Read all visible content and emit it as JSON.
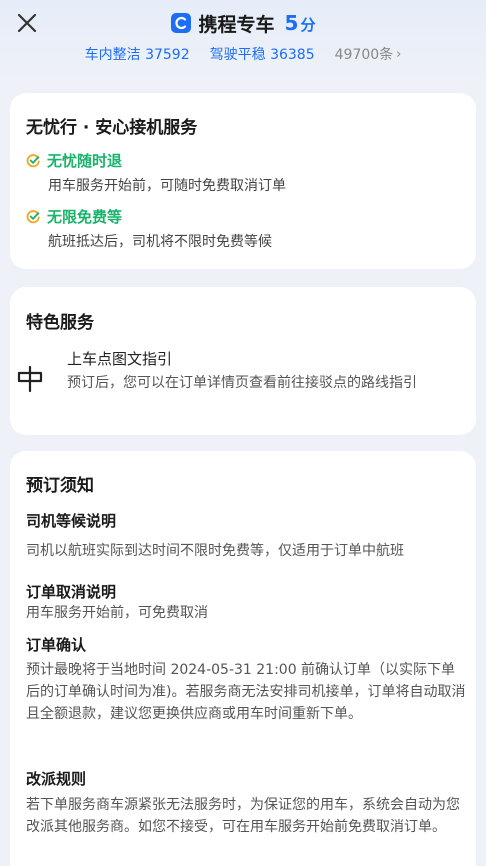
{
  "header": {
    "title": "携程专车",
    "score": "5",
    "score_unit": "分",
    "stats": [
      {
        "label": "车内整洁 37592"
      },
      {
        "label": "驾驶平稳 36385"
      }
    ],
    "review_count": "49700条"
  },
  "card_service": {
    "title": "无忧行 · 安心接机服务",
    "features": [
      {
        "name": "无忧随时退",
        "desc": "用车服务开始前，可随时免费取消订单"
      },
      {
        "name": "无限免费等",
        "desc": "航班抵达后，司机将不限时免费等候"
      }
    ]
  },
  "card_special": {
    "title": "特色服务",
    "item_name": "上车点图文指引",
    "item_desc": "预订后，您可以在订单详情页查看前往接驳点的路线指引"
  },
  "card_notice": {
    "title": "预订须知",
    "sections": [
      {
        "title": "司机等候说明",
        "text": "司机以航班实际到达时间不限时免费等，仅适用于订单中航班"
      },
      {
        "title": "订单取消说明",
        "text": "用车服务开始前，可免费取消"
      },
      {
        "title": "订单确认",
        "text": "预计最晚将于当地时间 2024-05-31 21:00 前确认订单（以实际下单后的订单确认时间为准)。若服务商无法安排司机接单，订单将自动取消且全额退款，建议您更换供应商或用车时间重新下单。"
      },
      {
        "title": "改派规则",
        "text": "若下单服务商车源紧张无法服务时，为保证您的用车，系统会自动为您改派其他服务商。如您不接受，可在用车服务开始前免费取消订单。"
      }
    ]
  },
  "colors": {
    "accent_blue": "#1d6ef5",
    "feature_green": "#19b36b",
    "check_orange": "#f5a623"
  },
  "icons": [
    "close-icon",
    "brand-logo-icon",
    "chevron-right-icon",
    "check-icon",
    "route-guide-icon"
  ]
}
